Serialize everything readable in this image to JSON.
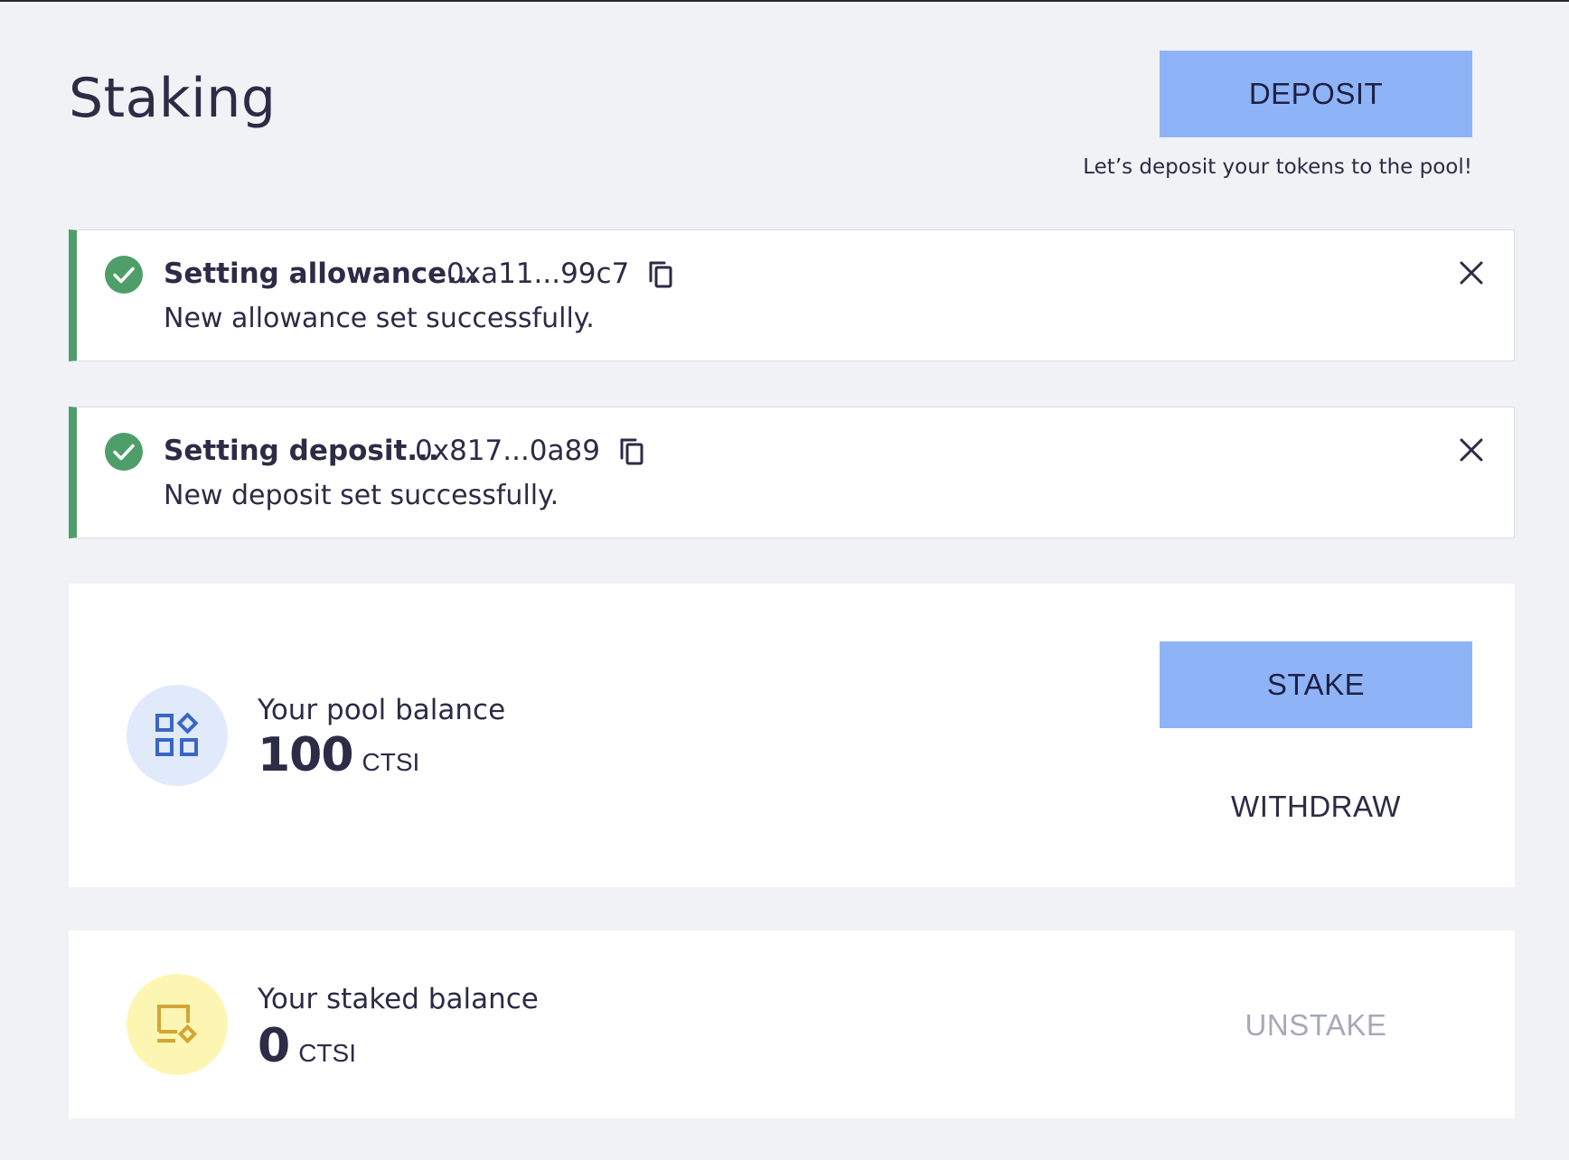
{
  "header": {
    "title": "Staking",
    "deposit_label": "DEPOSIT",
    "deposit_hint": "Let’s deposit your tokens to the pool!"
  },
  "toasts": [
    {
      "title": "Setting allowance...",
      "hash": "0xa11...99c7",
      "message": "New allowance set successfully.",
      "status": "success"
    },
    {
      "title": "Setting deposit...",
      "hash": "0x817...0a89",
      "message": "New deposit set successfully.",
      "status": "success"
    }
  ],
  "pool": {
    "label": "Your pool balance",
    "amount": "100",
    "unit": "CTSI",
    "icon": "pool-grid-icon",
    "stake_label": "STAKE",
    "withdraw_label": "WITHDRAW"
  },
  "staked": {
    "label": "Your staked balance",
    "amount": "0",
    "unit": "CTSI",
    "icon": "staked-device-icon",
    "unstake_label": "UNSTAKE",
    "unstake_enabled": false
  },
  "colors": {
    "background": "#f1f2f5",
    "primary_button": "#8eb4f7",
    "success": "#4f9e6a",
    "pool_badge": "#e1eafb",
    "staked_badge": "#fdf6b3",
    "pool_icon": "#3a66c4",
    "staked_icon": "#d4a435",
    "disabled_text": "#a8a9b6"
  }
}
